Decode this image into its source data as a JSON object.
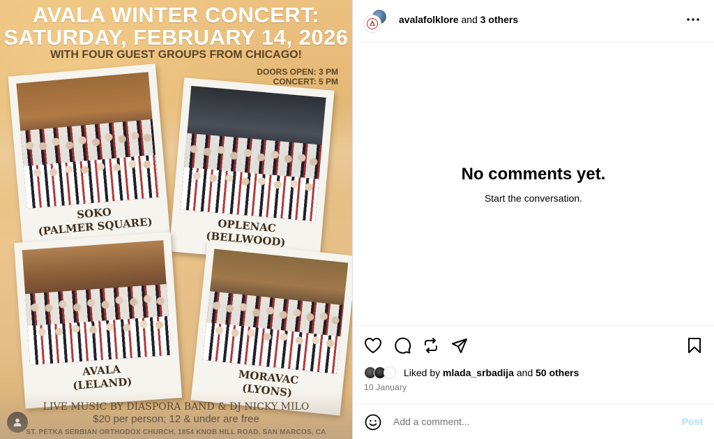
{
  "poster": {
    "title_line1": "AVALA WINTER CONCERT:",
    "title_line2": "SATURDAY, FEBRUARY 14, 2026",
    "subtitle": "WITH FOUR GUEST GROUPS FROM CHICAGO!",
    "doors": "DOORS OPEN: 3 PM",
    "concert": "CONCERT: 5 PM",
    "groups": [
      {
        "name": "SOKO",
        "place": "(PALMER SQUARE)"
      },
      {
        "name": "OPLENAC",
        "place": "(BELLWOOD)"
      },
      {
        "name": "AVALA",
        "place": "(LELAND)"
      },
      {
        "name": "MORAVAC",
        "place": "(LYONS)"
      }
    ],
    "music": "LIVE MUSIC BY DIASPORA BAND & DJ NICKY MILO",
    "price": "$20 per person; 12 & under are free",
    "venue": "ST. PETKA SERBIAN ORTHODOX CHURCH, 1854 KNOB HILL ROAD, SAN MARCOS, CA"
  },
  "header": {
    "username": "avalafolklore",
    "collab_text": " and ",
    "collab_count": "3 others"
  },
  "comments": {
    "empty_title": "No comments yet.",
    "empty_sub": "Start the conversation."
  },
  "likes": {
    "prefix": "Liked by ",
    "user": "mlada_srbadija",
    "mid": " and ",
    "others": "50 others"
  },
  "date": "10 January",
  "composer": {
    "placeholder": "Add a comment...",
    "post_label": "Post"
  },
  "colors": {
    "post_disabled": "#b3dbff",
    "muted_text": "#737373",
    "poster_bg": "#e2b574"
  },
  "icons": [
    "user-tag-icon",
    "more-options-icon",
    "heart-icon",
    "comment-icon",
    "repost-icon",
    "share-icon",
    "bookmark-icon",
    "emoji-icon"
  ]
}
